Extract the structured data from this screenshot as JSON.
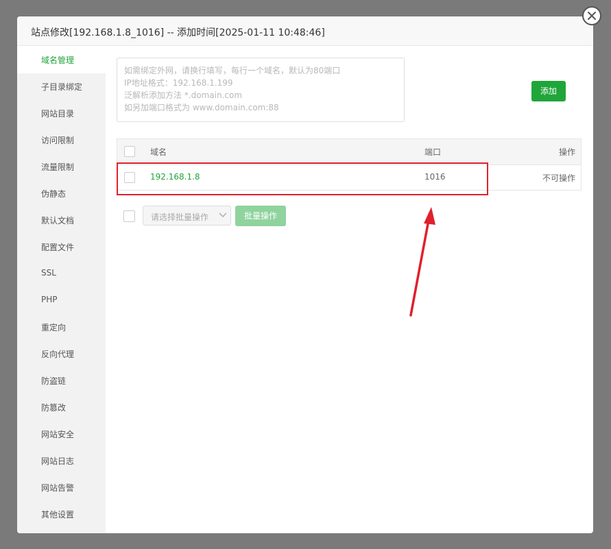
{
  "dialog": {
    "title": "站点修改[192.168.1.8_1016] -- 添加时间[2025-01-11 10:48:46]"
  },
  "sidebar": {
    "items": [
      {
        "label": "域名管理"
      },
      {
        "label": "子目录绑定"
      },
      {
        "label": "网站目录"
      },
      {
        "label": "访问限制"
      },
      {
        "label": "流量限制"
      },
      {
        "label": "伪静态"
      },
      {
        "label": "默认文档"
      },
      {
        "label": "配置文件"
      },
      {
        "label": "SSL"
      },
      {
        "label": "PHP"
      },
      {
        "label": "重定向"
      },
      {
        "label": "反向代理"
      },
      {
        "label": "防盗链"
      },
      {
        "label": "防篡改"
      },
      {
        "label": "网站安全"
      },
      {
        "label": "网站日志"
      },
      {
        "label": "网站告警"
      },
      {
        "label": "其他设置"
      }
    ]
  },
  "domain_input": {
    "placeholder_lines": [
      "如需绑定外网，请换行填写，每行一个域名，默认为80端口",
      "IP地址格式：192.168.1.199",
      "泛解析添加方法 *.domain.com",
      "如另加端口格式为 www.domain.com:88"
    ]
  },
  "add_button": {
    "label": "添加"
  },
  "table": {
    "headers": {
      "domain": "域名",
      "port": "端口",
      "action": "操作"
    },
    "rows": [
      {
        "domain": "192.168.1.8",
        "port": "1016",
        "action": "不可操作"
      }
    ]
  },
  "batch": {
    "select_placeholder": "请选择批量操作",
    "button_label": "批量操作"
  },
  "colors": {
    "accent": "#20a53a",
    "annotation": "#e0202c"
  },
  "icons": {
    "close": "close-icon",
    "dropdown": "chevron-down-icon"
  }
}
